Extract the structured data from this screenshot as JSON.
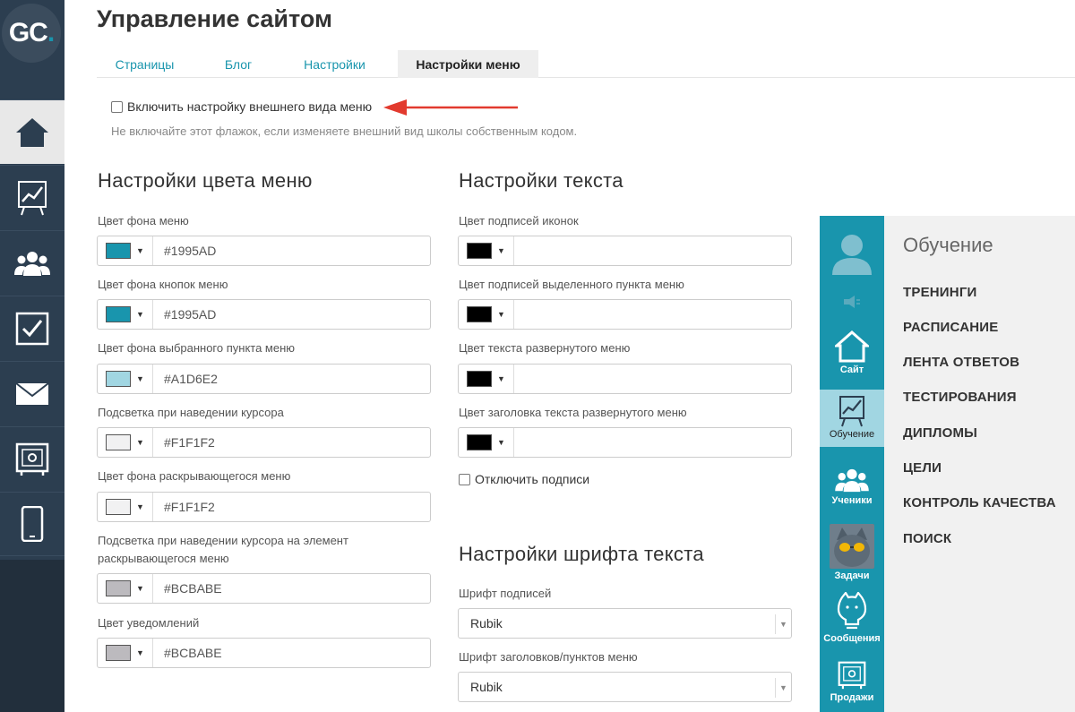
{
  "app": {
    "logo_text": "GC",
    "logo_dot": ".",
    "page_title": "Управление сайтом"
  },
  "sidebar": {
    "items": [
      {
        "icon": "home-icon",
        "active": true
      },
      {
        "icon": "chart-icon",
        "active": false
      },
      {
        "icon": "users-icon",
        "active": false
      },
      {
        "icon": "checkbox-icon",
        "active": false
      },
      {
        "icon": "mail-icon",
        "active": false
      },
      {
        "icon": "safe-icon",
        "active": false
      },
      {
        "icon": "phone-icon",
        "active": false
      }
    ]
  },
  "tabs": [
    {
      "label": "Страницы",
      "active": false
    },
    {
      "label": "Блог",
      "active": false
    },
    {
      "label": "Настройки",
      "active": false
    },
    {
      "label": "Настройки меню",
      "active": true
    }
  ],
  "menu_style": {
    "enable_label": "Включить настройку внешнего вида меню",
    "enabled": false,
    "hint": "Не включайте этот флажок, если изменяете внешний вид школы собственным кодом."
  },
  "color_settings": {
    "heading": "Настройки цвета меню",
    "fields": [
      {
        "label": "Цвет фона меню",
        "value": "#1995AD",
        "swatch": "#1995ad"
      },
      {
        "label": "Цвет фона кнопок меню",
        "value": "#1995AD",
        "swatch": "#1995ad"
      },
      {
        "label": "Цвет фона выбранного пункта меню",
        "value": "#A1D6E2",
        "swatch": "#a1d6e2"
      },
      {
        "label": "Подсветка при наведении курсора",
        "value": "#F1F1F2",
        "swatch": "#f1f1f2"
      },
      {
        "label": "Цвет фона раскрывающегося меню",
        "value": "#F1F1F2",
        "swatch": "#f1f1f2"
      },
      {
        "label_line1": "Подсветка при наведении курсора на элемент",
        "label_line2": "раскрывающегося меню",
        "value": "#BCBABE",
        "swatch": "#bcbabe"
      },
      {
        "label": "Цвет уведомлений",
        "value": "#BCBABE",
        "swatch": "#bcbabe"
      }
    ]
  },
  "text_settings": {
    "heading": "Настройки текста",
    "fields": [
      {
        "label": "Цвет подписей иконок",
        "value": "",
        "swatch": "#000000"
      },
      {
        "label": "Цвет подписей выделенного пункта меню",
        "value": "",
        "swatch": "#000000"
      },
      {
        "label": "Цвет текста развернутого меню",
        "value": "",
        "swatch": "#000000"
      },
      {
        "label": "Цвет заголовка текста развернутого меню",
        "value": "",
        "swatch": "#000000"
      }
    ],
    "disable_captions_label": "Отключить подписи"
  },
  "font_settings": {
    "heading": "Настройки шрифта текста",
    "caption_font_label": "Шрифт подписей",
    "caption_font_value": "Rubik",
    "heading_font_label": "Шрифт заголовков/пунктов меню",
    "heading_font_value": "Rubik"
  },
  "preview": {
    "bar_color": "#1995ad",
    "selected_color": "#a1d6e2",
    "bar_items": [
      {
        "label": "Сайт",
        "icon": "home-icon"
      },
      {
        "label": "Обучение",
        "icon": "chart-icon"
      },
      {
        "label": "Ученики",
        "icon": "users-icon"
      },
      {
        "label": "Задачи",
        "icon": "avatar-image"
      },
      {
        "label": "Сообщения",
        "icon": "bulb-cat-icon"
      },
      {
        "label": "Продажи",
        "icon": "safe-icon"
      }
    ],
    "title": "Обучение",
    "menu_items": [
      "ТРЕНИНГИ",
      "РАСПИСАНИЕ",
      "ЛЕНТА ОТВЕТОВ",
      "ТЕСТИРОВАНИЯ",
      "ДИПЛОМЫ",
      "ЦЕЛИ",
      "КОНТРОЛЬ КАЧЕСТВА",
      "ПОИСК"
    ]
  }
}
